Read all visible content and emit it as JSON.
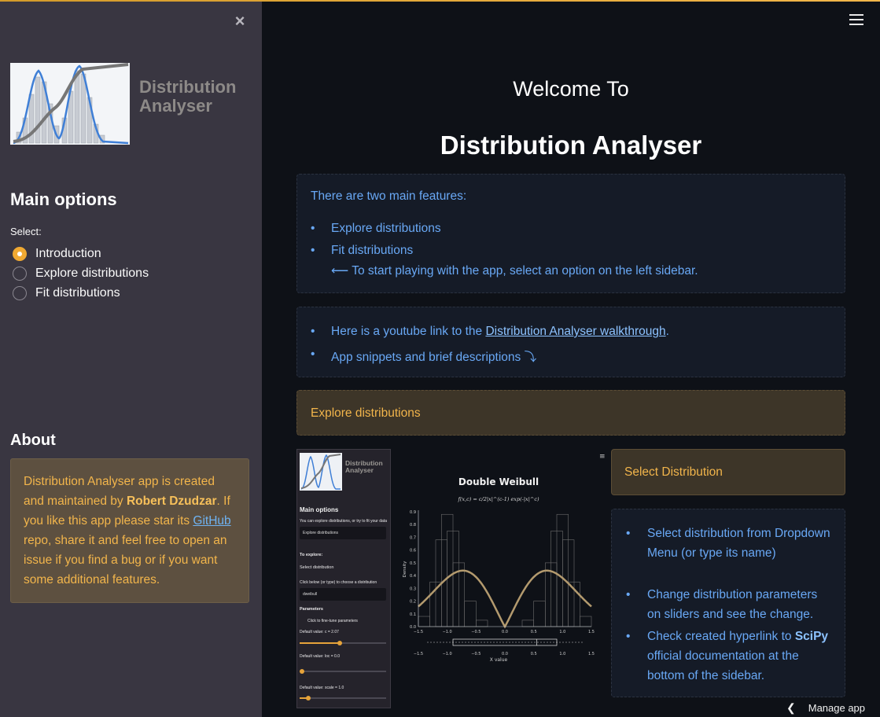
{
  "sidebar": {
    "logo_title": "Distribution Analyser",
    "main_options_heading": "Main options",
    "select_label": "Select:",
    "options": [
      {
        "label": "Introduction",
        "selected": true
      },
      {
        "label": "Explore distributions",
        "selected": false
      },
      {
        "label": "Fit distributions",
        "selected": false
      }
    ],
    "about_heading": "About",
    "about": {
      "p1": "Distribution Analyser app is created and maintained by ",
      "author": "Robert Dzudzar",
      "p2": ". If you like this app please star its ",
      "github": "GitHub",
      "p3": " repo, share it and feel free to open an issue if you find a bug or if you want some additional features."
    }
  },
  "main": {
    "welcome": "Welcome To",
    "title": "Distribution Analyser",
    "features_intro": "There are two main features:",
    "features": [
      "Explore distributions",
      "Fit distributions"
    ],
    "features_note": "⟵ To start playing with the app, select an option on the left sidebar.",
    "links": {
      "youtube_pre": "Here is a youtube link to the ",
      "youtube_link": "Distribution Analyser walkthrough",
      "youtube_post": ".",
      "snippets": "App snippets and brief descriptions ⤵"
    },
    "explore_header": "Explore distributions",
    "select_dist_header": "Select Distribution",
    "select_dist_points": {
      "b1": "Select distribution from Dropdown Menu (or type its name)",
      "b2": "Change distribution parameters on sliders and see the change.",
      "b3_pre": "Check created hyperlink to ",
      "b3_bold": "SciPy",
      "b3_post": " official documentation at the bottom of the sidebar."
    },
    "manage_app": "Manage app"
  },
  "snippet": {
    "logo_title": "Distribution Analyser",
    "main_options": "Main options",
    "hint": "You can explore distributions, or try to fit your data",
    "dropdown1": "Explore distributions",
    "to_explore": "To explore:",
    "select_distribution": "Select distribution",
    "click_below": "Click below (or type) to choose a distribution",
    "dropdown2": "dweibull",
    "parameters": "Parameters",
    "fine_tune": "Click to fine-tune parameters",
    "c_label": "Default value: c = 2.07",
    "loc_label": "Default value: loc = 0.0",
    "scale_label": "Default value: scale = 1.0"
  },
  "chart_data": {
    "type": "bar",
    "title": "Double Weibull",
    "formula": "f(x,c) = c/2|x|^(c-1) exp(-|x|^c)",
    "xlabel": "X value",
    "ylabel": "Density",
    "xlim": [
      -1.5,
      1.5
    ],
    "ylim": [
      0.0,
      0.9
    ],
    "x_ticks": [
      "−1.5",
      "−1.0",
      "−0.5",
      "0.0",
      "0.5",
      "1.0",
      "1.5"
    ],
    "y_ticks": [
      "0.0",
      "0.1",
      "0.2",
      "0.3",
      "0.4",
      "0.5",
      "0.6",
      "0.7",
      "0.8",
      "0.9"
    ],
    "hist_bins": [
      {
        "x": -1.4,
        "y": 0.08
      },
      {
        "x": -1.2,
        "y": 0.35
      },
      {
        "x": -1.1,
        "y": 0.68
      },
      {
        "x": -1.0,
        "y": 0.88
      },
      {
        "x": -0.9,
        "y": 0.75
      },
      {
        "x": -0.8,
        "y": 0.5
      },
      {
        "x": -0.6,
        "y": 0.2
      },
      {
        "x": -0.4,
        "y": 0.05
      },
      {
        "x": 0.4,
        "y": 0.05
      },
      {
        "x": 0.6,
        "y": 0.2
      },
      {
        "x": 0.8,
        "y": 0.5
      },
      {
        "x": 0.9,
        "y": 0.75
      },
      {
        "x": 1.0,
        "y": 0.88
      },
      {
        "x": 1.1,
        "y": 0.68
      },
      {
        "x": 1.2,
        "y": 0.35
      },
      {
        "x": 1.4,
        "y": 0.08
      }
    ],
    "colors": {
      "curve": "#b39a6e",
      "bars": "#6e6e6e",
      "axes": "#cfd3da"
    }
  }
}
